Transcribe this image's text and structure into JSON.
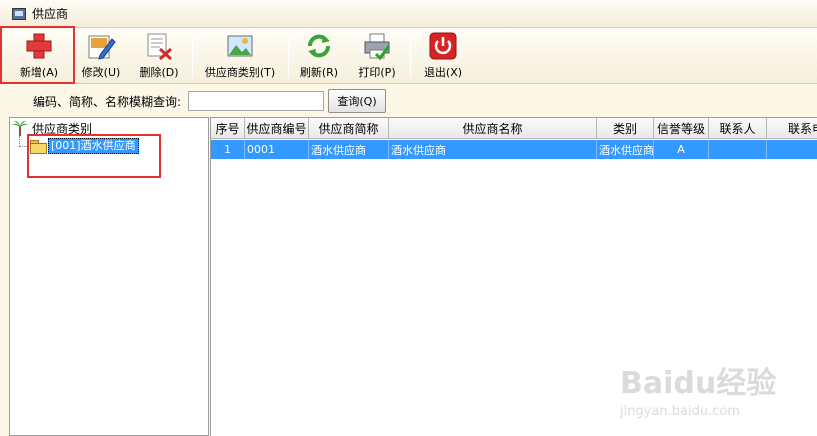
{
  "window": {
    "title": "供应商"
  },
  "toolbar": {
    "add": "新增(A)",
    "edit": "修改(U)",
    "delete": "删除(D)",
    "category": "供应商类别(T)",
    "refresh": "刷新(R)",
    "print": "打印(P)",
    "exit": "退出(X)"
  },
  "search": {
    "label": "编码、简称、名称模糊查询:",
    "value": "",
    "button": "查询(Q)"
  },
  "tree": {
    "root": "供应商类别",
    "child": "[001]酒水供应商"
  },
  "grid": {
    "columns": [
      "序号",
      "供应商编号",
      "供应商简称",
      "供应商名称",
      "类别",
      "信誉等级",
      "联系人",
      "联系电"
    ],
    "rows": [
      [
        "1",
        "0001",
        "酒水供应商",
        "酒水供应商",
        "酒水供应商",
        "A",
        "",
        ""
      ]
    ]
  },
  "watermark": {
    "logo": "Baidu经验",
    "url": "jingyan.baidu.com"
  },
  "colors": {
    "selection": "#3399ff",
    "highlight": "#e23232",
    "background": "#fdf7e8"
  }
}
